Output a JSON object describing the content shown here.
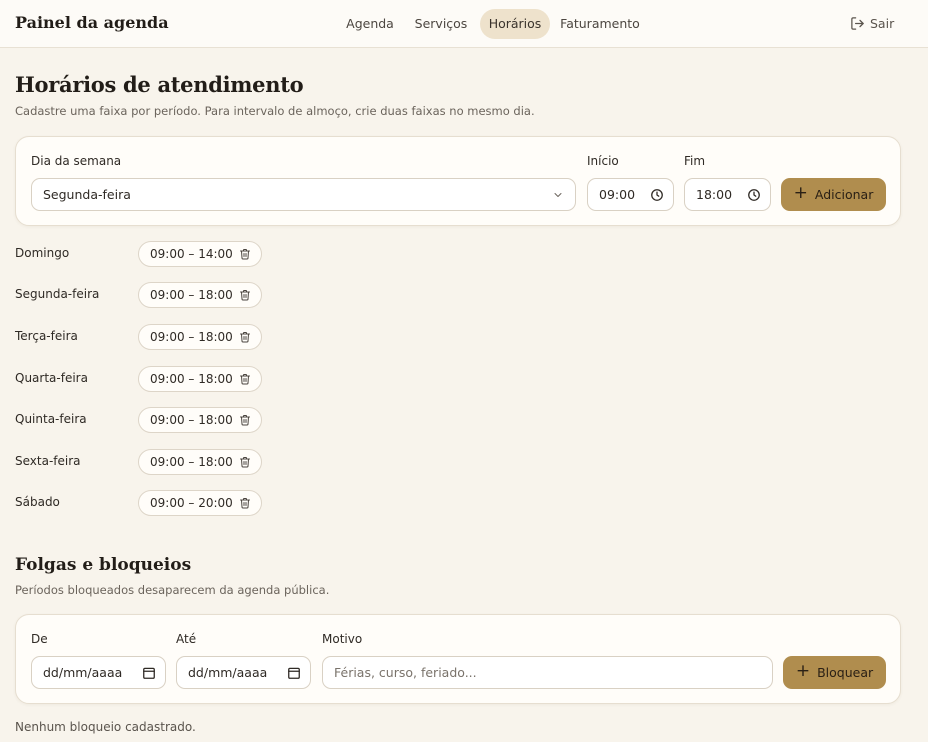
{
  "header": {
    "brand": "Painel da agenda",
    "nav": [
      {
        "label": "Agenda",
        "active": false
      },
      {
        "label": "Serviços",
        "active": false
      },
      {
        "label": "Horários",
        "active": true
      },
      {
        "label": "Faturamento",
        "active": false
      }
    ],
    "logout_label": "Sair"
  },
  "hours": {
    "title": "Horários de atendimento",
    "subtitle": "Cadastre uma faixa por período. Para intervalo de almoço, crie duas faixas no mesmo dia.",
    "form": {
      "day_label": "Dia da semana",
      "day_value": "Segunda-feira",
      "start_label": "Início",
      "start_value": "09:00",
      "end_label": "Fim",
      "end_value": "18:00",
      "add_label": "Adicionar"
    },
    "schedule": [
      {
        "day": "Domingo",
        "range": "09:00 – 14:00"
      },
      {
        "day": "Segunda-feira",
        "range": "09:00 – 18:00"
      },
      {
        "day": "Terça-feira",
        "range": "09:00 – 18:00"
      },
      {
        "day": "Quarta-feira",
        "range": "09:00 – 18:00"
      },
      {
        "day": "Quinta-feira",
        "range": "09:00 – 18:00"
      },
      {
        "day": "Sexta-feira",
        "range": "09:00 – 18:00"
      },
      {
        "day": "Sábado",
        "range": "09:00 – 20:00"
      }
    ]
  },
  "blocks": {
    "title": "Folgas e bloqueios",
    "subtitle": "Períodos bloqueados desaparecem da agenda pública.",
    "form": {
      "from_label": "De",
      "from_placeholder": "dd/mm/aaaa",
      "to_label": "Até",
      "to_placeholder": "dd/mm/aaaa",
      "reason_label": "Motivo",
      "reason_placeholder": "Férias, curso, feriado...",
      "block_label": "Bloquear"
    },
    "empty": "Nenhum bloqueio cadastrado."
  },
  "icons": {
    "logout": "logout-icon",
    "chevron": "chevron-down-icon",
    "clock": "clock-icon",
    "calendar": "calendar-icon",
    "trash": "trash-icon",
    "plus": "plus-icon"
  },
  "colors": {
    "background": "#f8f4ec",
    "accent": "#b08d4e",
    "nav_active": "#eee2cc"
  }
}
